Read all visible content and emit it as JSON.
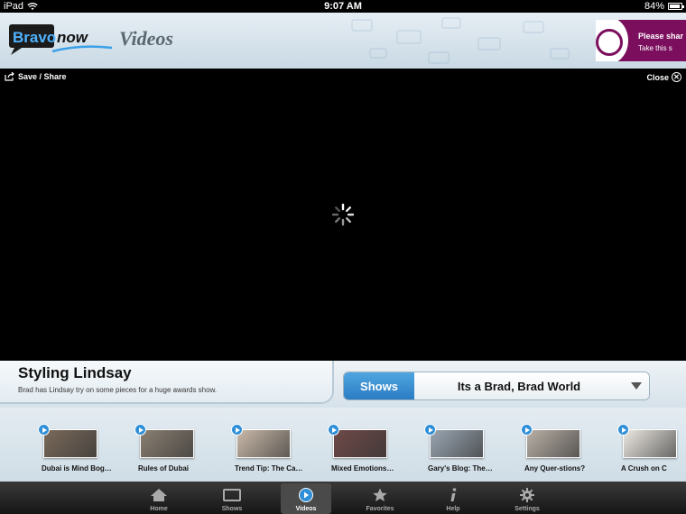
{
  "status": {
    "device": "iPad",
    "time": "9:07 AM",
    "battery": "84%"
  },
  "header": {
    "logo_word1": "Bravo",
    "logo_word2": "now",
    "section_title": "Videos",
    "ad_line1": "Please shar",
    "ad_line2": "Take this s"
  },
  "video": {
    "save_share": "Save / Share",
    "close": "Close",
    "close_glyph": "✕"
  },
  "info": {
    "title": "Styling Lindsay",
    "description": "Brad has Lindsay try on some pieces for a huge awards show."
  },
  "shows": {
    "button": "Shows",
    "selected": "Its a Brad, Brad World"
  },
  "thumbnails": [
    {
      "caption": "Dubai is Mind Bog…",
      "color": "#7a6a5a"
    },
    {
      "caption": "Rules of Dubai",
      "color": "#8a7f72"
    },
    {
      "caption": "Trend Tip: The Ca…",
      "color": "#c9b9a8"
    },
    {
      "caption": "Mixed Emotions…",
      "color": "#6e4a48"
    },
    {
      "caption": "Gary's Blog: The…",
      "color": "#9aa6b2"
    },
    {
      "caption": "Any Quer-stions?",
      "color": "#b9b0a6"
    },
    {
      "caption": "A Crush on C",
      "color": "#ece8e2"
    }
  ],
  "tabs": [
    {
      "label": "Home",
      "icon": "home-icon"
    },
    {
      "label": "Shows",
      "icon": "tv-icon"
    },
    {
      "label": "Videos",
      "icon": "play-icon"
    },
    {
      "label": "Favorites",
      "icon": "star-icon"
    },
    {
      "label": "Help",
      "icon": "info-icon"
    },
    {
      "label": "Settings",
      "icon": "gear-icon"
    }
  ],
  "colors": {
    "accent": "#2f8fd8",
    "ad": "#7b0f5e"
  }
}
